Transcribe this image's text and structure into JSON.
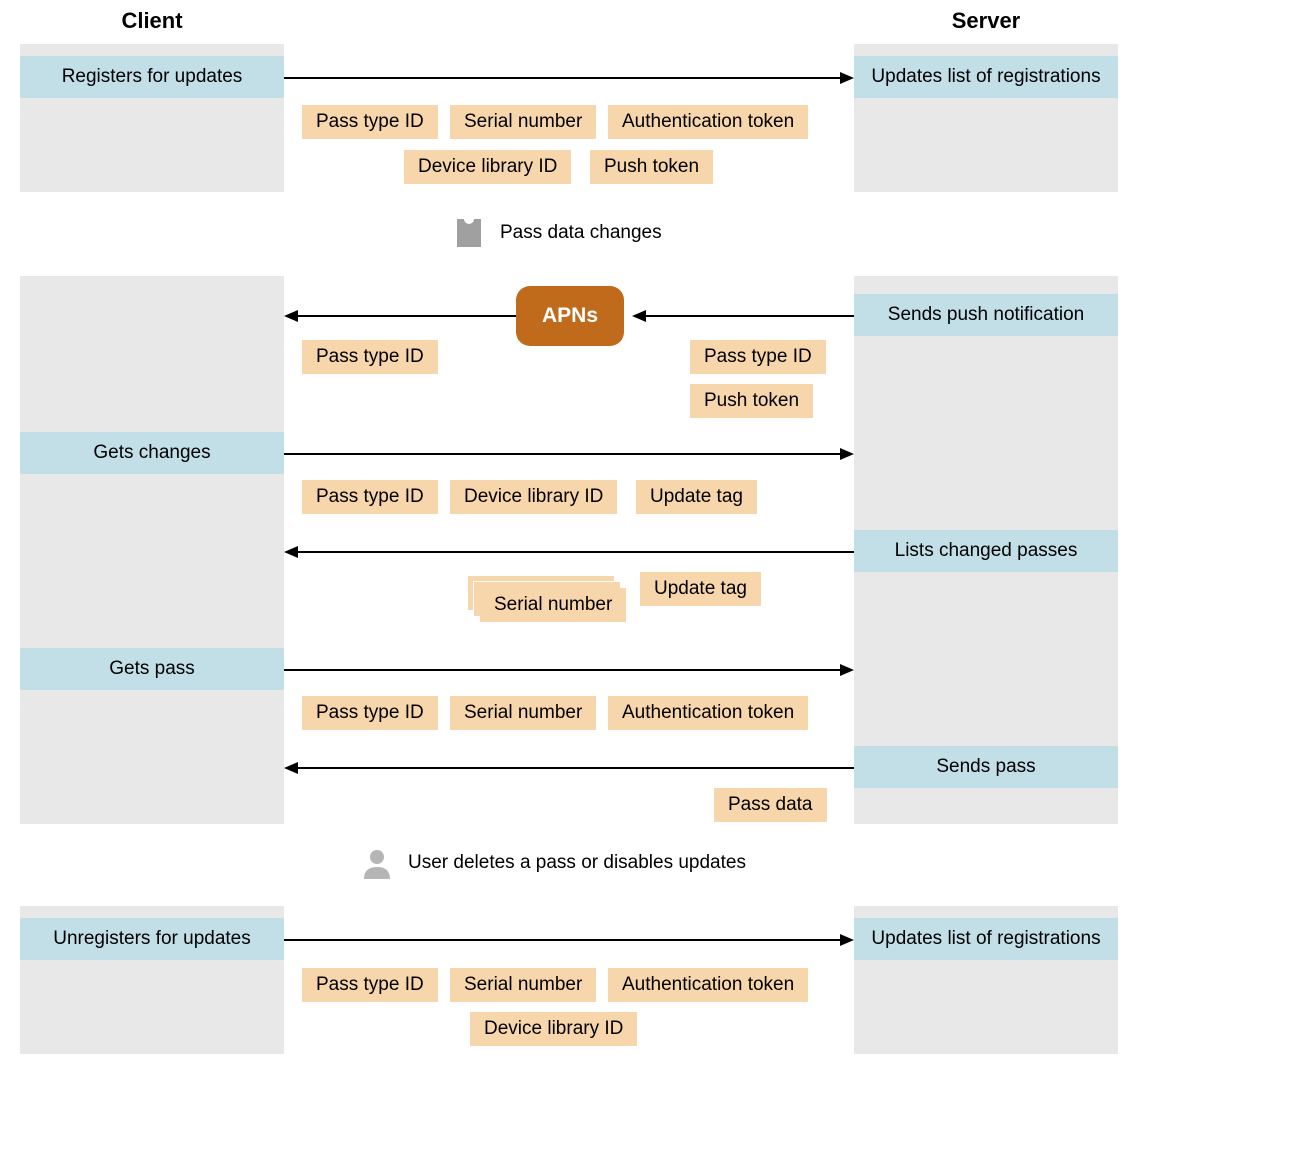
{
  "headers": {
    "client": "Client",
    "server": "Server"
  },
  "apns_label": "APNs",
  "actions": {
    "registers_for_updates": "Registers for updates",
    "updates_list_of_registrations": "Updates list of registrations",
    "sends_push_notification": "Sends push notification",
    "gets_changes": "Gets changes",
    "lists_changed_passes": "Lists changed passes",
    "gets_pass": "Gets pass",
    "sends_pass": "Sends pass",
    "unregisters_for_updates": "Unregisters for updates"
  },
  "payloads": {
    "pass_type_id": "Pass type ID",
    "serial_number": "Serial number",
    "authentication_token": "Authentication token",
    "device_library_id": "Device library ID",
    "push_token": "Push token",
    "update_tag": "Update tag",
    "pass_data": "Pass data"
  },
  "interjections": {
    "pass_data_changes": "Pass data changes",
    "user_deletes_pass": "User deletes a pass or disables updates"
  }
}
